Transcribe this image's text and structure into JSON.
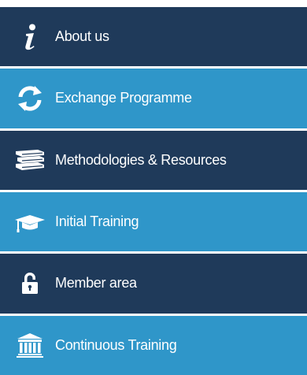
{
  "menu": {
    "items": [
      {
        "label": "About us",
        "icon": "info-icon",
        "theme": "dark"
      },
      {
        "label": "Exchange Programme",
        "icon": "exchange-arrows-icon",
        "theme": "light"
      },
      {
        "label": "Methodologies & Resources",
        "icon": "books-icon",
        "theme": "dark"
      },
      {
        "label": "Initial Training",
        "icon": "graduation-cap-icon",
        "theme": "light"
      },
      {
        "label": "Member area",
        "icon": "padlock-icon",
        "theme": "dark"
      },
      {
        "label": "Continuous Training",
        "icon": "institution-icon",
        "theme": "light"
      }
    ]
  },
  "colors": {
    "dark": "#1f3a5a",
    "light": "#2f96c9",
    "text": "#ffffff"
  }
}
